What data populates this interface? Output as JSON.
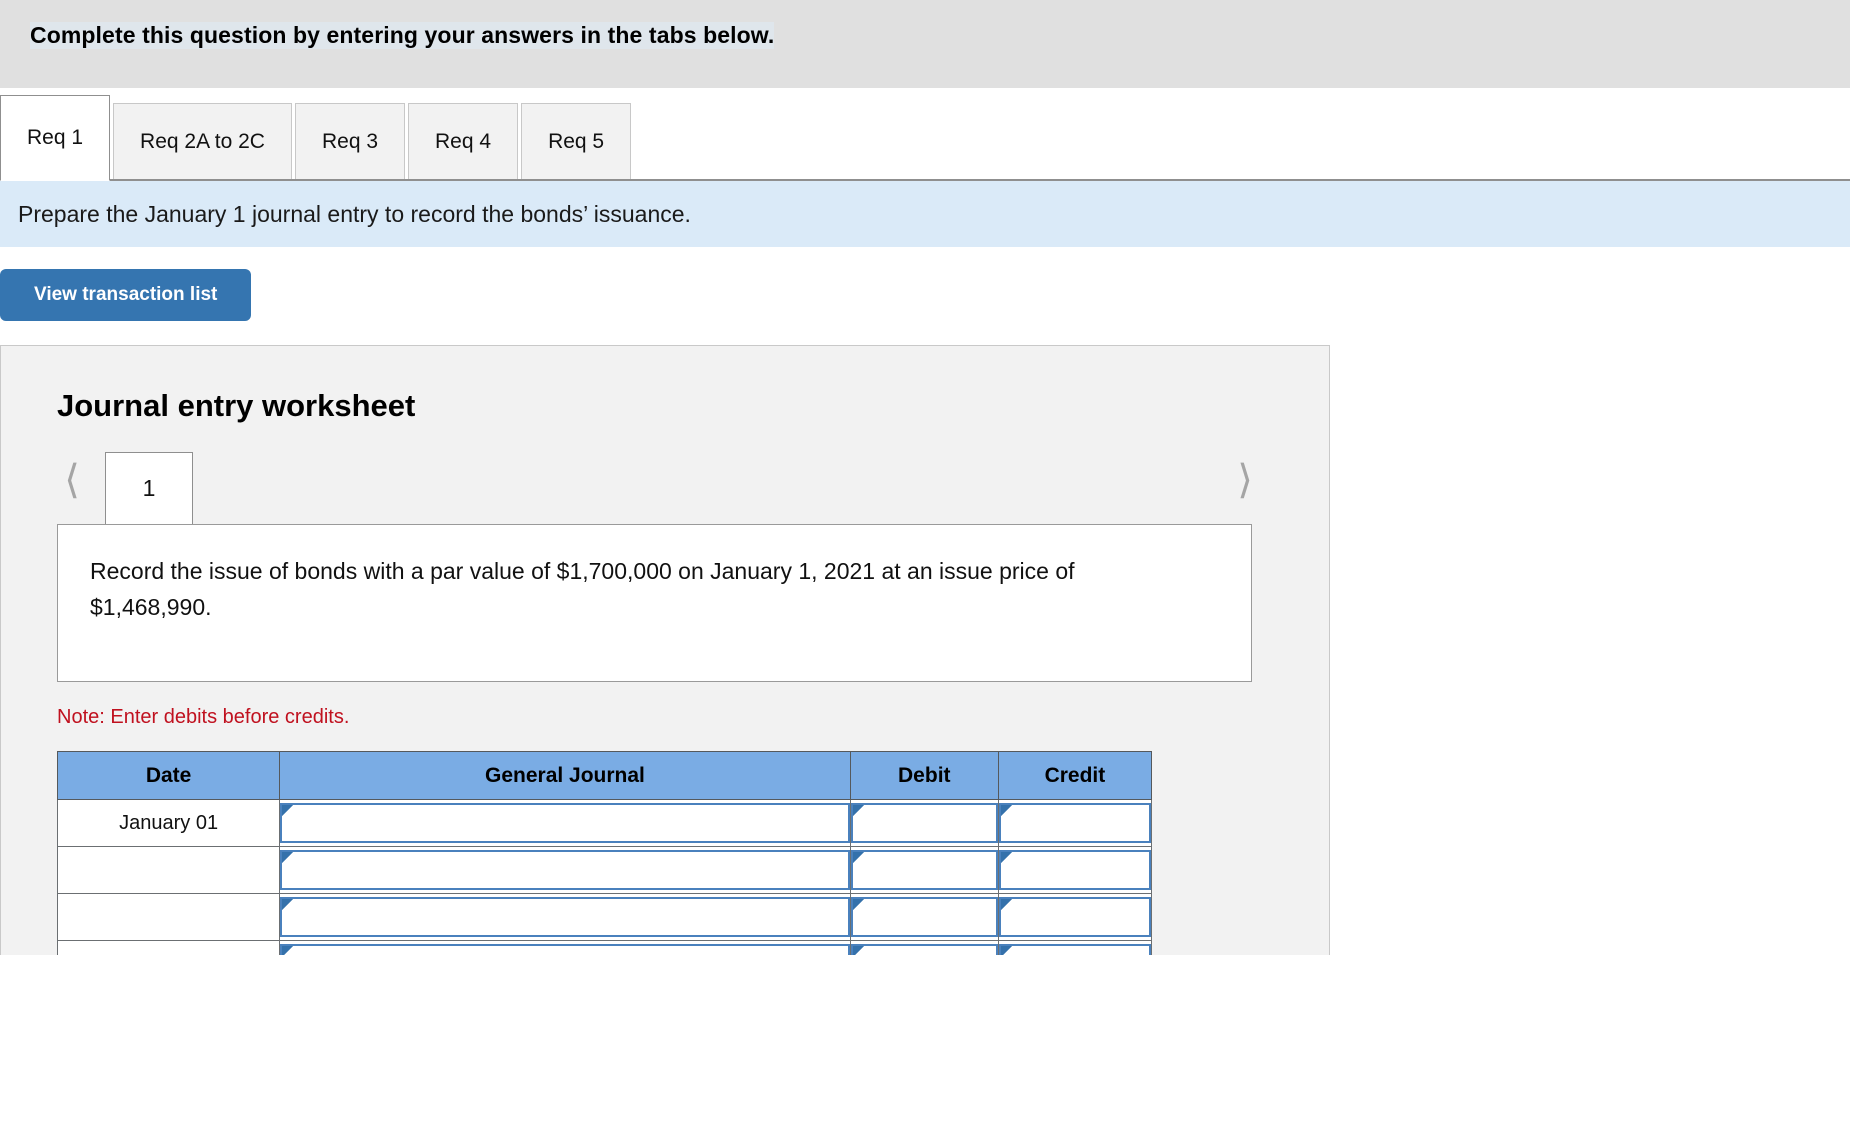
{
  "header": {
    "instruction": "Complete this question by entering your answers in the tabs below."
  },
  "tabs": [
    {
      "label": "Req 1",
      "active": true
    },
    {
      "label": "Req 2A to 2C",
      "active": false
    },
    {
      "label": "Req 3",
      "active": false
    },
    {
      "label": "Req 4",
      "active": false
    },
    {
      "label": "Req 5",
      "active": false
    }
  ],
  "requirement": {
    "text": "Prepare the January 1 journal entry to record the bonds’ issuance."
  },
  "toolbar": {
    "view_transaction_list_label": "View transaction list"
  },
  "worksheet": {
    "title": "Journal entry worksheet",
    "pager": {
      "prev_icon": "chevron-left-icon",
      "next_icon": "chevron-right-icon",
      "current_page": "1"
    },
    "transaction_description": "Record the issue of bonds with a par value of $1,700,000 on January 1, 2021 at an issue price of $1,468,990.",
    "note": "Note: Enter debits before credits.",
    "table": {
      "columns": [
        "Date",
        "General Journal",
        "Debit",
        "Credit"
      ],
      "rows": [
        {
          "date": "January 01",
          "general_journal": "",
          "debit": "",
          "credit": ""
        },
        {
          "date": "",
          "general_journal": "",
          "debit": "",
          "credit": ""
        },
        {
          "date": "",
          "general_journal": "",
          "debit": "",
          "credit": ""
        },
        {
          "date": "",
          "general_journal": "",
          "debit": "",
          "credit": ""
        },
        {
          "date": "",
          "general_journal": "",
          "debit": "",
          "credit": ""
        },
        {
          "date": "",
          "general_journal": "",
          "debit": "",
          "credit": ""
        }
      ]
    }
  },
  "colors": {
    "topbar_gray": "#e0e0e0",
    "requirement_blue": "#daeaf8",
    "button_blue": "#3575b0",
    "table_header_blue": "#7aace4",
    "input_border_blue": "#4a81bd",
    "note_red": "#c0111f",
    "panel_gray": "#f2f2f2"
  }
}
